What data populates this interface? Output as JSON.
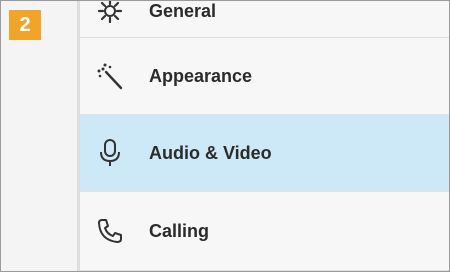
{
  "step_badge": "2",
  "settings_menu": {
    "items": [
      {
        "label": "General",
        "icon": "gear-icon",
        "active": false
      },
      {
        "label": "Appearance",
        "icon": "magic-wand-icon",
        "active": false
      },
      {
        "label": "Audio & Video",
        "icon": "microphone-icon",
        "active": true
      },
      {
        "label": "Calling",
        "icon": "phone-icon",
        "active": false
      }
    ]
  },
  "colors": {
    "badge": "#f2a42a",
    "active_row": "#cde8f6",
    "menu_bg": "#f7f7f7"
  }
}
